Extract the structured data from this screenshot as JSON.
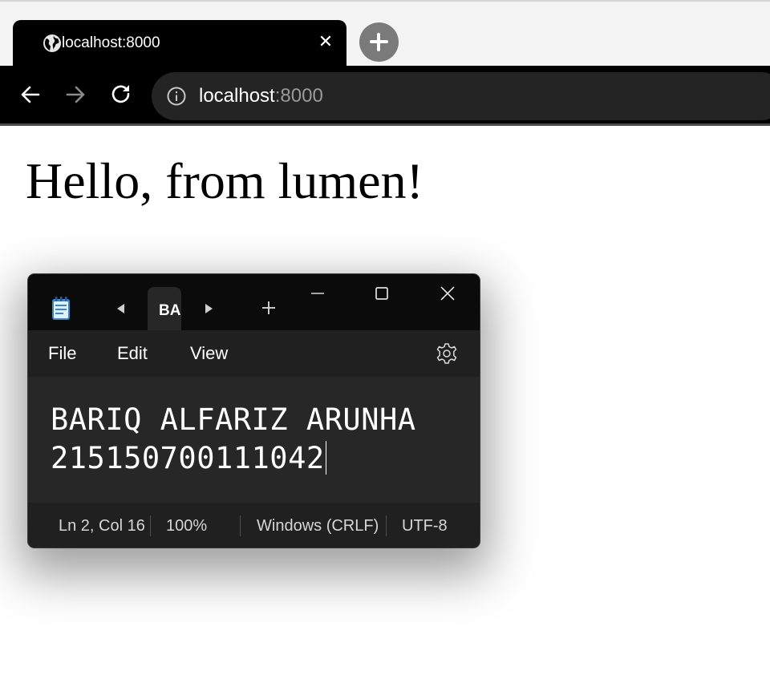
{
  "browser": {
    "tab": {
      "title": "localhost:8000",
      "icon": "globe-icon",
      "close_icon": "✕"
    },
    "new_tab_icon": "plus-icon",
    "nav": {
      "back_icon": "arrow-left-icon",
      "forward_icon": "arrow-right-icon",
      "reload_icon": "reload-icon"
    },
    "address": {
      "host": "localhost",
      "port": ":8000",
      "icon": "info-icon"
    }
  },
  "page": {
    "heading": "Hello, from lumen!"
  },
  "notepad": {
    "tab_title": "BARIQ ALFARIZ ARUNHA",
    "menu": {
      "file": "File",
      "edit": "Edit",
      "view": "View"
    },
    "content": {
      "line1": "BARIQ ALFARIZ ARUNHA",
      "line2": "215150700111042"
    },
    "status": {
      "position": "Ln 2, Col 16",
      "zoom": "100%",
      "line_ending": "Windows (CRLF)",
      "encoding": "UTF-8"
    },
    "colors": {
      "editor_bg": "#272727",
      "titlebar_bg": "#0b0b0b",
      "menubar_bg": "#202020"
    }
  }
}
